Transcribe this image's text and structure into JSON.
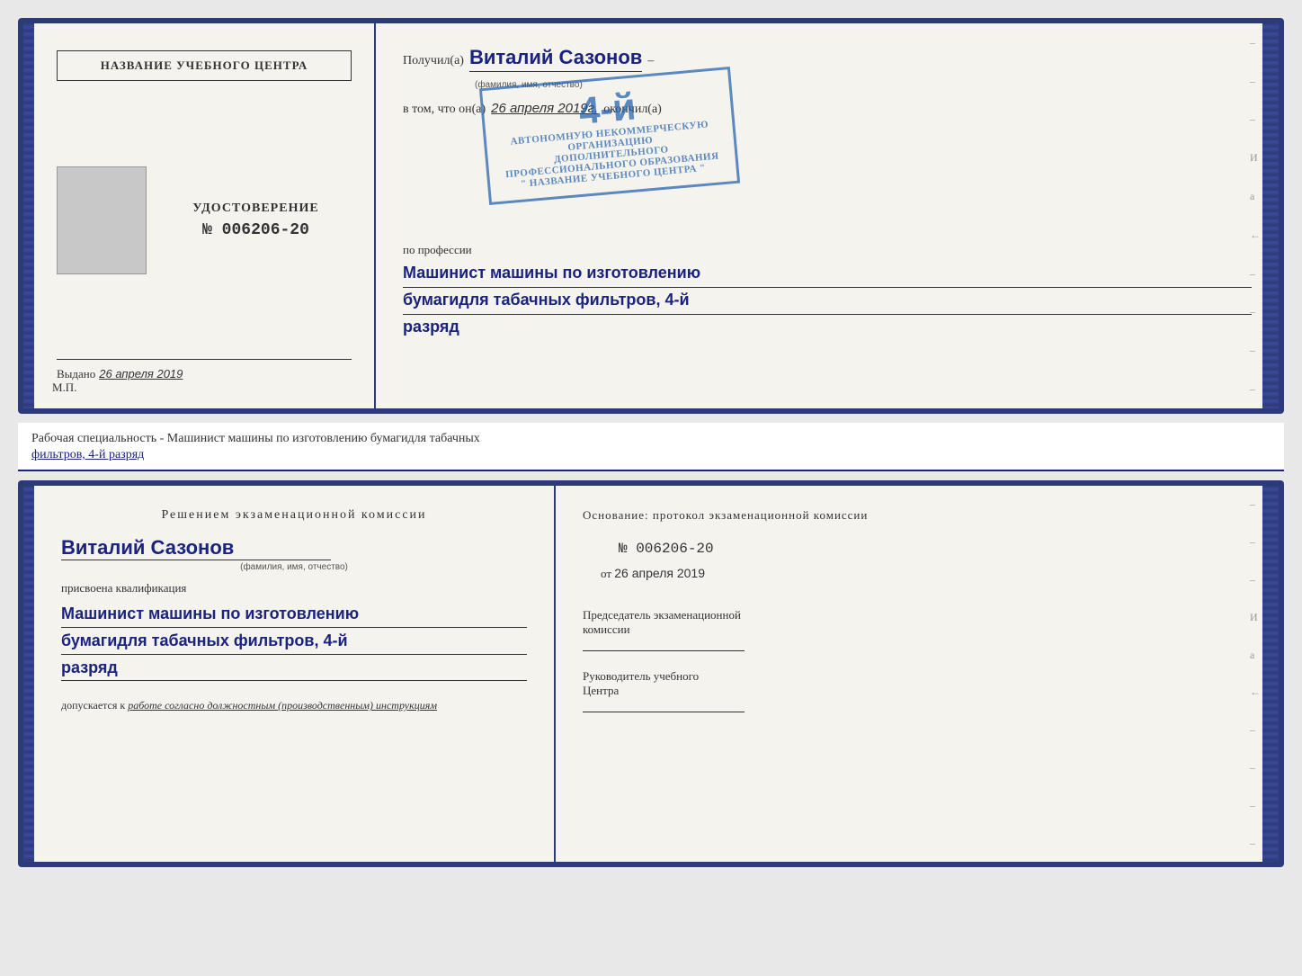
{
  "page": {
    "background": "#e8e8e8"
  },
  "top_document": {
    "left": {
      "header": "НАЗВАНИЕ УЧЕБНОГО ЦЕНТРА",
      "cert_label": "УДОСТОВЕРЕНИЕ",
      "cert_number": "№ 006206-20",
      "issued_label": "Выдано",
      "issued_date": "26 апреля 2019",
      "mp_label": "М.П."
    },
    "right": {
      "received_prefix": "Получил(а)",
      "recipient_name": "Виталий Сазонов",
      "recipient_caption": "(фамилия, имя, отчество)",
      "dash": "–",
      "in_that_prefix": "в том, что он(а)",
      "date_handwritten": "26 апреля 2019г.",
      "finished_label": "окончил(а)",
      "stamp_number": "4-й",
      "stamp_line1": "АВТОНОМНУЮ НЕКОММЕРЧЕСКУЮ ОРГАНИЗАЦИЮ",
      "stamp_line2": "ДОПОЛНИТЕЛЬНОГО ПРОФЕССИОНАЛЬНОГО ОБРАЗОВАНИЯ",
      "stamp_line3": "\" НАЗВАНИЕ УЧЕБНОГО ЦЕНТРА \"",
      "profession_prefix": "по профессии",
      "profession_line1": "Машинист машины по изготовлению",
      "profession_line2": "бумагидля табачных фильтров, 4-й",
      "profession_line3": "разряд"
    }
  },
  "info_bar": {
    "text_prefix": "Рабочая специальность - Машинист машины по изготовлению бумагидля табачных",
    "text_underline": "фильтров, 4-й разряд"
  },
  "bottom_document": {
    "left": {
      "title": "Решением  экзаменационной  комиссии",
      "name": "Виталий Сазонов",
      "name_caption": "(фамилия, имя, отчество)",
      "qualification_label": "присвоена квалификация",
      "qual_line1": "Машинист машины по изготовлению",
      "qual_line2": "бумагидля табачных фильтров, 4-й",
      "qual_line3": "разряд",
      "allowed_prefix": "допускается к",
      "allowed_text": "работе согласно должностным (производственным) инструкциям"
    },
    "right": {
      "basis_label": "Основание: протокол экзаменационной  комиссии",
      "protocol_number": "№  006206-20",
      "date_prefix": "от",
      "date_value": "26 апреля 2019",
      "commission_chair_line1": "Председатель экзаменационной",
      "commission_chair_line2": "комиссии",
      "center_head_line1": "Руководитель учебного",
      "center_head_line2": "Центра"
    }
  },
  "side_chars": {
    "top_right_1": "–",
    "top_right_2": "–",
    "top_right_3": "–",
    "top_right_4": "И",
    "top_right_5": "а",
    "top_right_6": "←",
    "top_right_7": "–",
    "top_right_8": "–",
    "top_right_9": "–",
    "top_right_10": "–"
  }
}
